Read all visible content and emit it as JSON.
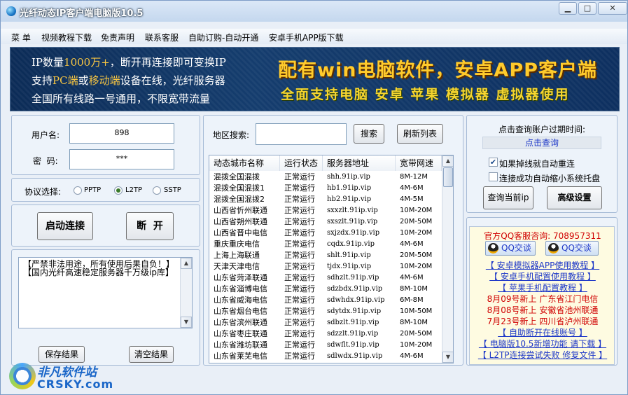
{
  "window": {
    "title": "光纤动态IP客户端电脑版10.5",
    "min": "▁",
    "max": "□",
    "close": "✕"
  },
  "menu": [
    "菜 单",
    "视频教程下载",
    "免责声明",
    "联系客服",
    "自助订购-自动开通",
    "安卓手机APP版下载"
  ],
  "banner": {
    "line1_a": "IP数量",
    "line1_hl": "1000万+",
    "line1_b": "，断开再连接即可变换IP",
    "line2_a": "支持",
    "line2_hl1": "PC端",
    "line2_b": "或",
    "line2_hl2": "移动端",
    "line2_c": "设备在线，光纤服务器",
    "line3": "全国所有线路一号通用，不限宽带流量",
    "right1": "配有win电脑软件，安卓APP客户端",
    "right2": "全面支持电脑 安卓 苹果 模拟器 虚拟器使用"
  },
  "login": {
    "user_label": "用户名:",
    "user_value": "898",
    "pwd_label": "密  码:",
    "pwd_value": "***"
  },
  "protocol": {
    "label": "协议选择:",
    "options": [
      "PPTP",
      "L2TP",
      "SSTP"
    ],
    "selected": "L2TP"
  },
  "actions": {
    "connect": "启动连接",
    "disconnect": "断  开"
  },
  "log": {
    "lines": [
      "【严禁非法用途，所有使用后果自负！】",
      "【国内光纤高速稳定服务器千万级ip库】"
    ],
    "save": "保存结果",
    "clear": "清空结果"
  },
  "search": {
    "label": "地区搜索:",
    "value": "",
    "search_btn": "搜索",
    "refresh_btn": "刷新列表"
  },
  "table": {
    "headers": [
      "动态城市名称",
      "运行状态",
      "服务器地址",
      "宽带网速"
    ],
    "rows": [
      [
        "混拨全国混拨",
        "正常运行",
        "shh.91ip.vip",
        "8M-12M"
      ],
      [
        "混拨全国混拨1",
        "正常运行",
        "hb1.91ip.vip",
        "4M-6M"
      ],
      [
        "混拨全国混拨2",
        "正常运行",
        "hb2.91ip.vip",
        "4M-5M"
      ],
      [
        "山西省忻州联通",
        "正常运行",
        "sxxzlt.91ip.vip",
        "10M-20M"
      ],
      [
        "山西省朔州联通",
        "正常运行",
        "sxszlt.91ip.vip",
        "20M-50M"
      ],
      [
        "山西省晋中电信",
        "正常运行",
        "sxjzdx.91ip.vip",
        "10M-20M"
      ],
      [
        "重庆重庆电信",
        "正常运行",
        "cqdx.91ip.vip",
        "4M-6M"
      ],
      [
        "上海上海联通",
        "正常运行",
        "shlt.91ip.vip",
        "20M-50M"
      ],
      [
        "天津天津电信",
        "正常运行",
        "tjdx.91ip.vip",
        "10M-20M"
      ],
      [
        "山东省菏泽联通",
        "正常运行",
        "sdhzlt.91ip.vip",
        "4M-6M"
      ],
      [
        "山东省淄博电信",
        "正常运行",
        "sdzbdx.91ip.vip",
        "8M-10M"
      ],
      [
        "山东省威海电信",
        "正常运行",
        "sdwhdx.91ip.vip",
        "6M-8M"
      ],
      [
        "山东省烟台电信",
        "正常运行",
        "sdytdx.91ip.vip",
        "10M-50M"
      ],
      [
        "山东省滨州联通",
        "正常运行",
        "sdbzlt.91ip.vip",
        "8M-10M"
      ],
      [
        "山东省枣庄联通",
        "正常运行",
        "sdzzlt.91ip.vip",
        "20M-50M"
      ],
      [
        "山东省潍坊联通",
        "正常运行",
        "sdwflt.91ip.vip",
        "10M-20M"
      ],
      [
        "山东省莱芜电信",
        "正常运行",
        "sdlwdx.91ip.vip",
        "4M-6M"
      ]
    ]
  },
  "account": {
    "expire_label": "点击查询账户过期时间:",
    "query_link": "点击查询",
    "reconnect": {
      "label": "如果掉线就自动重连",
      "checked": true
    },
    "minimize": {
      "label": "连接成功自动缩小系统托盘",
      "checked": false
    },
    "query_ip": "查询当前ip",
    "advanced": "高级设置"
  },
  "ad": {
    "qq_line": "官方QQ客服咨询: 708957311",
    "qq_btn": "QQ交谈",
    "links": [
      {
        "text": "【 安卓模拟器APP使用教程 】",
        "style": "blue"
      },
      {
        "text": "【 安卓手机配置使用教程 】",
        "style": "blue"
      },
      {
        "text": "【 苹果手机配置教程 】",
        "style": "blue"
      },
      {
        "text": "8月09号新上 广东省江门电信",
        "style": "red"
      },
      {
        "text": "8月08号新上 安徽省池州联通",
        "style": "red"
      },
      {
        "text": "7月23号新上 四川省泸州联通",
        "style": "red"
      },
      {
        "text": "【 自助断开在线账号 】",
        "style": "blue"
      },
      {
        "text": "【 电脑版10.5新增功能 请下载 】",
        "style": "blue"
      },
      {
        "text": "【 L2TP连接尝试失败 修复文件 】",
        "style": "blue"
      }
    ]
  },
  "watermark": {
    "name": "非凡软件站",
    "domain": "CRSKY.com"
  },
  "colors": {
    "title_bar": "#c4d7ee",
    "banner_bg": "#153d6e",
    "banner_gold": "#ffcb2c",
    "red": "#d00000",
    "link": "#1f39c8"
  }
}
